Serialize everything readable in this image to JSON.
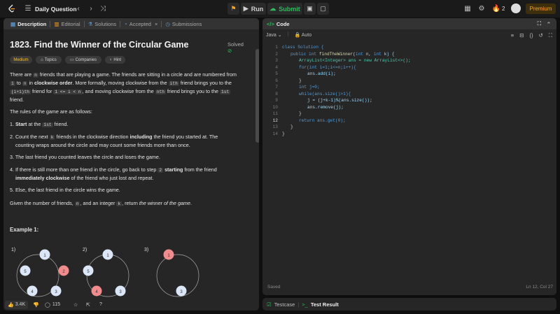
{
  "topbar": {
    "title": "Daily Question",
    "run_label": "Run",
    "submit_label": "Submit",
    "streak_count": "2",
    "premium_label": "Premium"
  },
  "left_tabs": [
    {
      "label": "Description"
    },
    {
      "label": "Editorial"
    },
    {
      "label": "Solutions"
    },
    {
      "label": "Accepted"
    },
    {
      "label": "Submissions"
    }
  ],
  "problem": {
    "title": "1823. Find the Winner of the Circular Game",
    "status": "Solved",
    "difficulty": "Medium",
    "tags_label": "Topics",
    "companies_label": "Companies",
    "hint_label": "Hint",
    "p1_a": "There are",
    "p1_n": "n",
    "p1_b": "friends that are playing a game. The friends are sitting in a circle and are numbered from",
    "p1_1": "1",
    "p1_to": "to",
    "p1_n2": "n",
    "p1_c": "in",
    "p1_cw": "clockwise order",
    "p1_d": ". More formally, moving clockwise from the",
    "p1_ith": "ith",
    "p1_e": "friend brings you to the",
    "p1_i1": "(i+1)th",
    "p1_f": "friend for",
    "p1_cond": "1 <= i < n",
    "p1_g": ", and moving clockwise from the",
    "p1_nth": "nth",
    "p1_h": "friend brings you to the",
    "p1_1st": "1st",
    "p1_i": "friend.",
    "rules_intro": "The rules of the game are as follows:",
    "r1_a": "1.",
    "r1_bold": "Start",
    "r1_b": "at the",
    "r1_code": "1st",
    "r1_c": "friend.",
    "r2_a": "2. Count the next",
    "r2_k": "k",
    "r2_b": "friends in the clockwise direction",
    "r2_bold": "including",
    "r2_c": "the friend you started at. The",
    "r2_d": "counting wraps around the circle and may count some friends more than once.",
    "r3": "3. The last friend you counted leaves the circle and loses the game.",
    "r4_a": "4. If there is still more than one friend in the circle, go back to step",
    "r4_2": "2",
    "r4_bold": "starting",
    "r4_b": "from the friend",
    "r4_bold2": "immediately clockwise",
    "r4_c": "of the friend who just lost and repeat.",
    "r5": "5. Else, the last friend in the circle wins the game.",
    "given_a": "Given the number of friends,",
    "given_n": "n",
    "given_b": ", and an integer",
    "given_k": "k",
    "given_c": ", return",
    "given_it": "the winner of the game",
    "given_d": ".",
    "example_label": "Example 1:"
  },
  "diagram": {
    "steps": [
      "1)",
      "2)",
      "3)"
    ],
    "n1": "1",
    "n2": "2",
    "n3": "3",
    "n4": "4",
    "n5": "5",
    "red": "#f28b8b",
    "blue": "#dbe7f7"
  },
  "bottom": {
    "likes": "3.4K",
    "comments": "115"
  },
  "code_panel": {
    "title": "Code",
    "lang": "Java",
    "auto": "Auto",
    "saved": "Saved",
    "position": "Ln 12, Col 27"
  },
  "code_lines": [
    "1",
    "2",
    "3",
    "4",
    "5",
    "6",
    "7",
    "8",
    "9",
    "10",
    "11",
    "12",
    "13",
    "14"
  ],
  "code_text": {
    "l1": "class Solution {",
    "l2a": "public",
    "l2b": "int",
    "l2c": "findTheWinner",
    "l2d": "(",
    "l2e": "int",
    "l2f": " n, ",
    "l2g": "int",
    "l2h": " k) {",
    "l3": "ArrayList<Integer> ans = new ArrayList<>();",
    "l4": "for(int i=1;i<=n;i++){",
    "l5": "ans.add(i);",
    "l6": "}",
    "l7": "int j=0;",
    "l8": "while(ans.size()>1){",
    "l9": "j = (j+k-1)%(ans.size());",
    "l10": "ans.remove(j);",
    "l11": "}",
    "l12": "return ans.get(0);",
    "l13": "}",
    "l14": "}"
  },
  "test_panel": {
    "testcase": "Testcase",
    "result": "Test Result"
  }
}
